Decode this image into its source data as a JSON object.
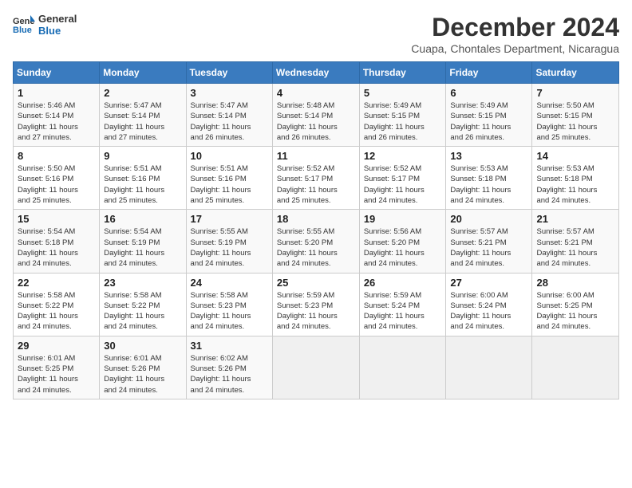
{
  "logo": {
    "line1": "General",
    "line2": "Blue"
  },
  "title": "December 2024",
  "location": "Cuapa, Chontales Department, Nicaragua",
  "days_header": [
    "Sunday",
    "Monday",
    "Tuesday",
    "Wednesday",
    "Thursday",
    "Friday",
    "Saturday"
  ],
  "weeks": [
    [
      {
        "day": "1",
        "info": "Sunrise: 5:46 AM\nSunset: 5:14 PM\nDaylight: 11 hours\nand 27 minutes."
      },
      {
        "day": "2",
        "info": "Sunrise: 5:47 AM\nSunset: 5:14 PM\nDaylight: 11 hours\nand 27 minutes."
      },
      {
        "day": "3",
        "info": "Sunrise: 5:47 AM\nSunset: 5:14 PM\nDaylight: 11 hours\nand 26 minutes."
      },
      {
        "day": "4",
        "info": "Sunrise: 5:48 AM\nSunset: 5:14 PM\nDaylight: 11 hours\nand 26 minutes."
      },
      {
        "day": "5",
        "info": "Sunrise: 5:49 AM\nSunset: 5:15 PM\nDaylight: 11 hours\nand 26 minutes."
      },
      {
        "day": "6",
        "info": "Sunrise: 5:49 AM\nSunset: 5:15 PM\nDaylight: 11 hours\nand 26 minutes."
      },
      {
        "day": "7",
        "info": "Sunrise: 5:50 AM\nSunset: 5:15 PM\nDaylight: 11 hours\nand 25 minutes."
      }
    ],
    [
      {
        "day": "8",
        "info": "Sunrise: 5:50 AM\nSunset: 5:16 PM\nDaylight: 11 hours\nand 25 minutes."
      },
      {
        "day": "9",
        "info": "Sunrise: 5:51 AM\nSunset: 5:16 PM\nDaylight: 11 hours\nand 25 minutes."
      },
      {
        "day": "10",
        "info": "Sunrise: 5:51 AM\nSunset: 5:16 PM\nDaylight: 11 hours\nand 25 minutes."
      },
      {
        "day": "11",
        "info": "Sunrise: 5:52 AM\nSunset: 5:17 PM\nDaylight: 11 hours\nand 25 minutes."
      },
      {
        "day": "12",
        "info": "Sunrise: 5:52 AM\nSunset: 5:17 PM\nDaylight: 11 hours\nand 24 minutes."
      },
      {
        "day": "13",
        "info": "Sunrise: 5:53 AM\nSunset: 5:18 PM\nDaylight: 11 hours\nand 24 minutes."
      },
      {
        "day": "14",
        "info": "Sunrise: 5:53 AM\nSunset: 5:18 PM\nDaylight: 11 hours\nand 24 minutes."
      }
    ],
    [
      {
        "day": "15",
        "info": "Sunrise: 5:54 AM\nSunset: 5:18 PM\nDaylight: 11 hours\nand 24 minutes."
      },
      {
        "day": "16",
        "info": "Sunrise: 5:54 AM\nSunset: 5:19 PM\nDaylight: 11 hours\nand 24 minutes."
      },
      {
        "day": "17",
        "info": "Sunrise: 5:55 AM\nSunset: 5:19 PM\nDaylight: 11 hours\nand 24 minutes."
      },
      {
        "day": "18",
        "info": "Sunrise: 5:55 AM\nSunset: 5:20 PM\nDaylight: 11 hours\nand 24 minutes."
      },
      {
        "day": "19",
        "info": "Sunrise: 5:56 AM\nSunset: 5:20 PM\nDaylight: 11 hours\nand 24 minutes."
      },
      {
        "day": "20",
        "info": "Sunrise: 5:57 AM\nSunset: 5:21 PM\nDaylight: 11 hours\nand 24 minutes."
      },
      {
        "day": "21",
        "info": "Sunrise: 5:57 AM\nSunset: 5:21 PM\nDaylight: 11 hours\nand 24 minutes."
      }
    ],
    [
      {
        "day": "22",
        "info": "Sunrise: 5:58 AM\nSunset: 5:22 PM\nDaylight: 11 hours\nand 24 minutes."
      },
      {
        "day": "23",
        "info": "Sunrise: 5:58 AM\nSunset: 5:22 PM\nDaylight: 11 hours\nand 24 minutes."
      },
      {
        "day": "24",
        "info": "Sunrise: 5:58 AM\nSunset: 5:23 PM\nDaylight: 11 hours\nand 24 minutes."
      },
      {
        "day": "25",
        "info": "Sunrise: 5:59 AM\nSunset: 5:23 PM\nDaylight: 11 hours\nand 24 minutes."
      },
      {
        "day": "26",
        "info": "Sunrise: 5:59 AM\nSunset: 5:24 PM\nDaylight: 11 hours\nand 24 minutes."
      },
      {
        "day": "27",
        "info": "Sunrise: 6:00 AM\nSunset: 5:24 PM\nDaylight: 11 hours\nand 24 minutes."
      },
      {
        "day": "28",
        "info": "Sunrise: 6:00 AM\nSunset: 5:25 PM\nDaylight: 11 hours\nand 24 minutes."
      }
    ],
    [
      {
        "day": "29",
        "info": "Sunrise: 6:01 AM\nSunset: 5:25 PM\nDaylight: 11 hours\nand 24 minutes."
      },
      {
        "day": "30",
        "info": "Sunrise: 6:01 AM\nSunset: 5:26 PM\nDaylight: 11 hours\nand 24 minutes."
      },
      {
        "day": "31",
        "info": "Sunrise: 6:02 AM\nSunset: 5:26 PM\nDaylight: 11 hours\nand 24 minutes."
      },
      {
        "day": "",
        "info": ""
      },
      {
        "day": "",
        "info": ""
      },
      {
        "day": "",
        "info": ""
      },
      {
        "day": "",
        "info": ""
      }
    ]
  ]
}
